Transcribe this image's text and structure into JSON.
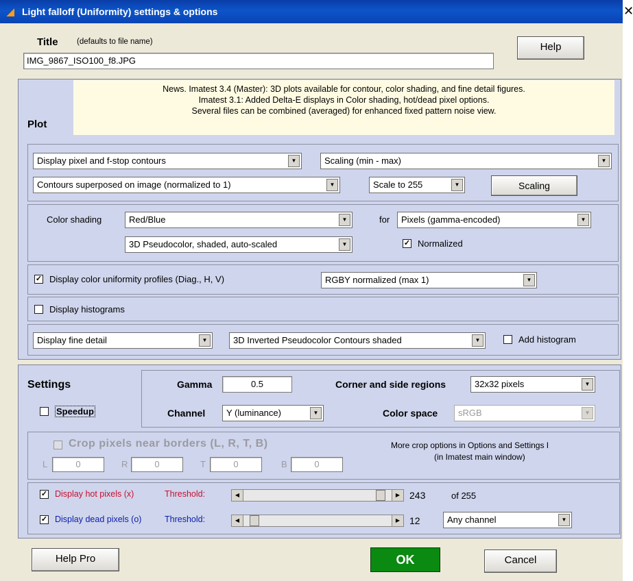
{
  "window": {
    "title": "Light falloff (Uniformity) settings & options",
    "close": "✕"
  },
  "title_section": {
    "label": "Title",
    "hint": "(defaults to file name)",
    "value": "IMG_9867_ISO100_f8.JPG",
    "help_button": "Help"
  },
  "plot": {
    "label": "Plot",
    "news": [
      "News. Imatest 3.4 (Master): 3D plots available for contour, color shading, and fine detail figures.",
      "Imatest 3.1: Added Delta-E displays in Color shading, hot/dead pixel options.",
      "Several files can be combined (averaged) for enhanced fixed pattern noise view."
    ],
    "contour_display": "Display pixel and f-stop contours",
    "scaling_mode": "Scaling (min - max)",
    "contour_overlay": "Contours superposed on image (normalized to 1)",
    "scale_to": "Scale to 255",
    "scaling_button": "Scaling",
    "color_shading_label": "Color shading",
    "color_shading_value": "Red/Blue",
    "for_label": "for",
    "for_value": "Pixels (gamma-encoded)",
    "shading_style": "3D Pseudocolor, shaded, auto-scaled",
    "normalized": {
      "label": "Normalized",
      "checked": true
    },
    "uniformity_profiles": {
      "label": "Display color uniformity profiles (Diag., H, V)",
      "checked": true
    },
    "profiles_mode": "RGBY normalized (max 1)",
    "histograms": {
      "label": "Display histograms",
      "checked": false
    },
    "fine_detail": "Display fine detail",
    "fine_detail_style": "3D Inverted Pseudocolor Contours shaded",
    "add_histogram": {
      "label": "Add histogram",
      "checked": false
    }
  },
  "settings": {
    "label": "Settings",
    "speedup": {
      "label": "Speedup",
      "checked": false
    },
    "gamma_label": "Gamma",
    "gamma_value": "0.5",
    "channel_label": "Channel",
    "channel_value": "Y (luminance)",
    "regions_label": "Corner and side regions",
    "regions_value": "32x32 pixels",
    "color_space_label": "Color space",
    "color_space_value": "sRGB"
  },
  "crop": {
    "label": "Crop pixels near borders (L, R, T, B)",
    "checked": false,
    "note_line1": "More crop options in Options and Settings I",
    "note_line2": "(in Imatest main window)",
    "fields": [
      {
        "letter": "L",
        "value": "0"
      },
      {
        "letter": "R",
        "value": "0"
      },
      {
        "letter": "T",
        "value": "0"
      },
      {
        "letter": "B",
        "value": "0"
      }
    ]
  },
  "pixels": {
    "hot_label": "Display hot pixels (x)",
    "hot_checked": true,
    "hot_threshold_label": "Threshold:",
    "hot_value": "243",
    "hot_fraction": 0.953,
    "of_label": "of 255",
    "dead_label": "Display dead pixels (o)",
    "dead_checked": true,
    "dead_threshold_label": "Threshold:",
    "dead_value": "12",
    "dead_fraction": 0.047,
    "channel_select": "Any channel"
  },
  "footer": {
    "help_pro": "Help Pro",
    "ok": "OK",
    "cancel": "Cancel"
  },
  "colors": {
    "titlebar": "#0c54c9",
    "panel": "#cfd5ec",
    "news_bg": "#fffbe3",
    "ok": "#0a8a10",
    "hot_label": "#c8102e",
    "dead_label": "#0a1da8"
  },
  "icons": {
    "check": "✓",
    "arrow_down": "▼",
    "arrow_left": "◀",
    "arrow_right": "▶"
  }
}
